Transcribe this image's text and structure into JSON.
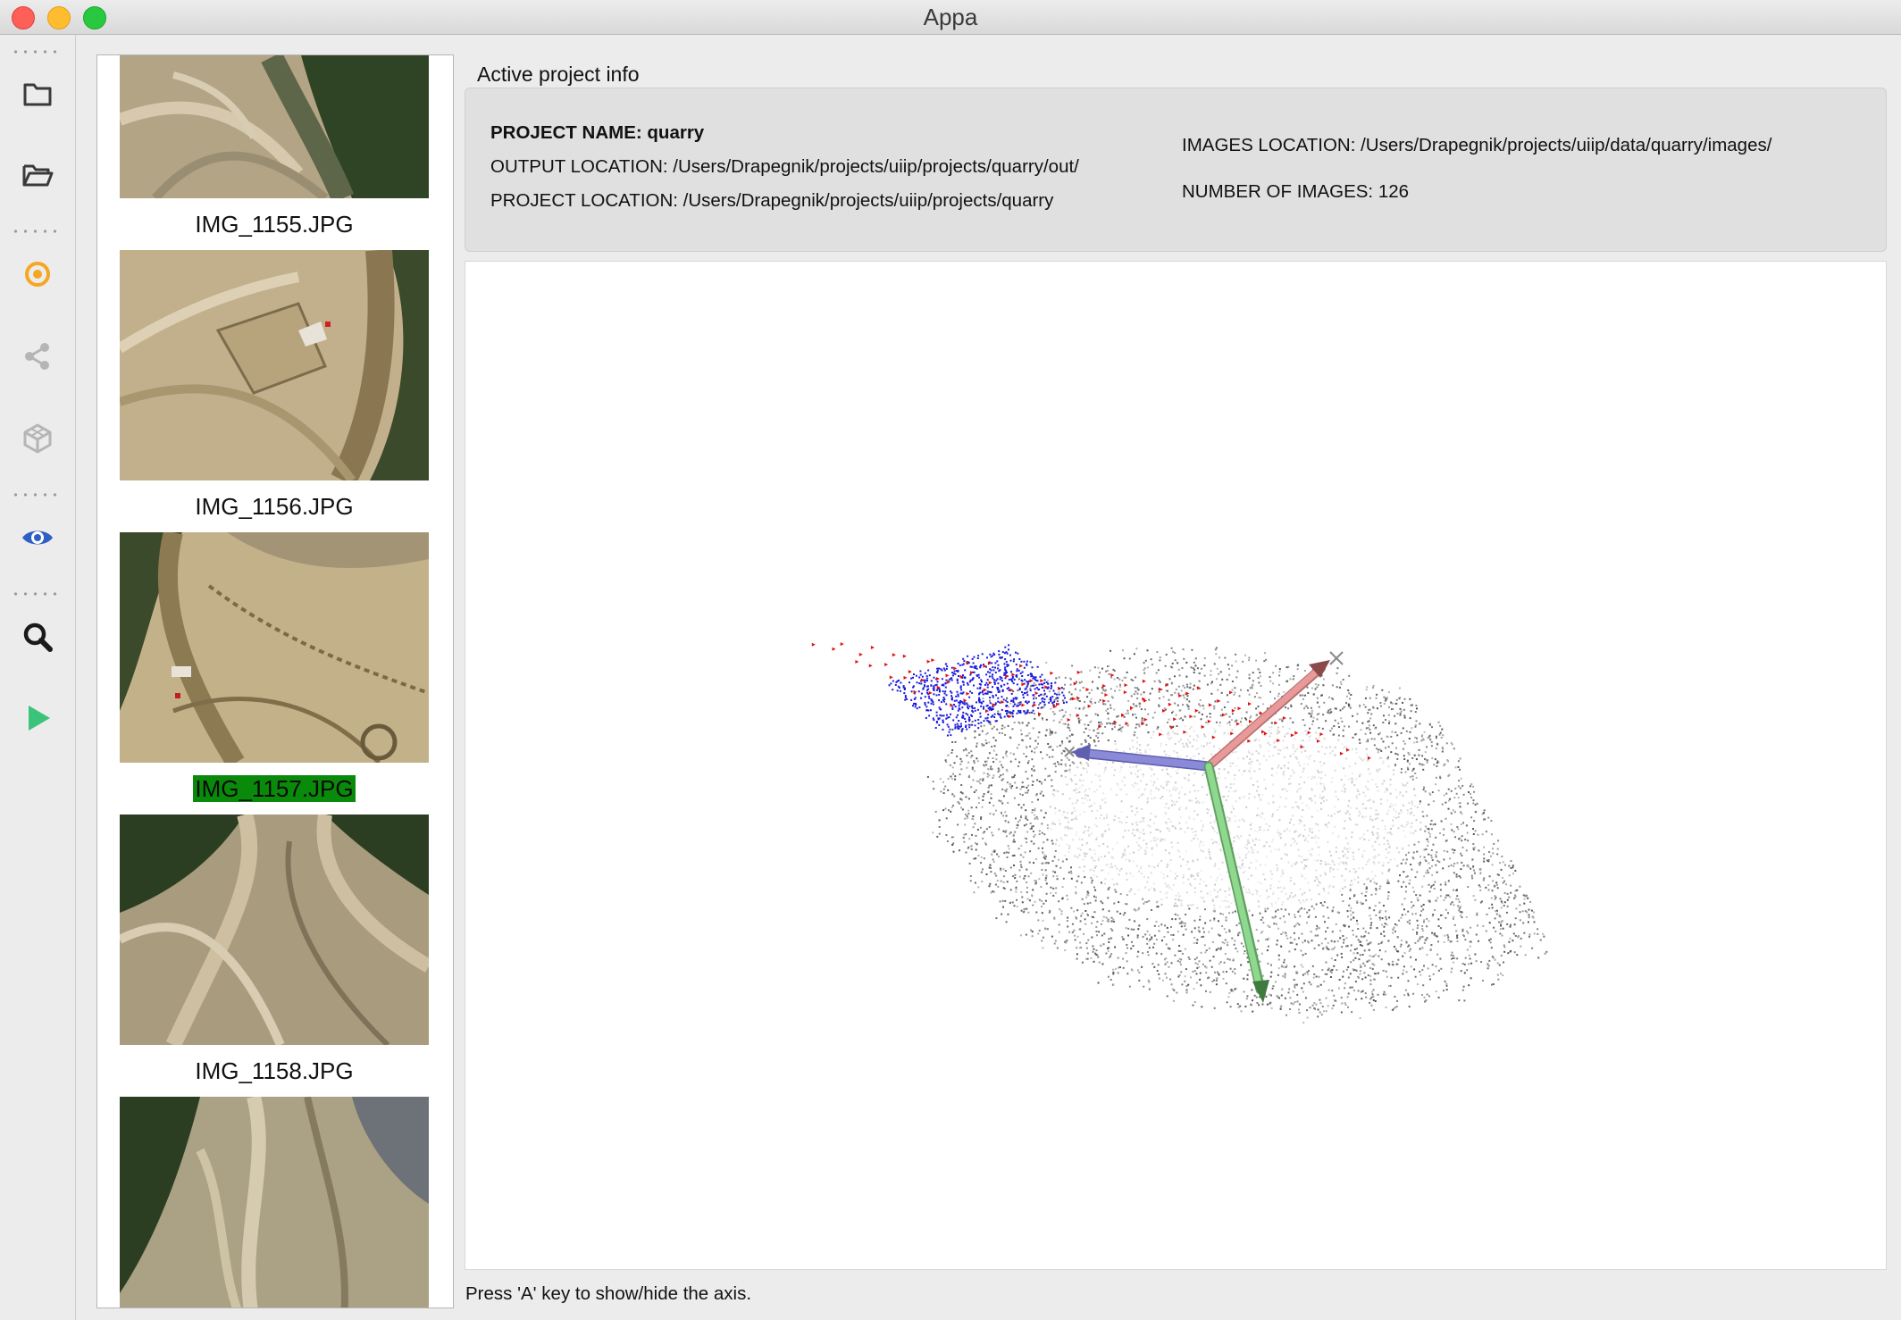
{
  "window": {
    "title": "Appa"
  },
  "toolbar": {
    "buttons": [
      {
        "name": "folder-icon",
        "color": "#3a3a3a"
      },
      {
        "name": "open-folder-icon",
        "color": "#3a3a3a"
      },
      {
        "name": "target-icon",
        "color": "#f5a623"
      },
      {
        "name": "share-icon",
        "color": "#b5b5b5"
      },
      {
        "name": "cube-icon",
        "color": "#b5b5b5"
      },
      {
        "name": "eye-icon",
        "color": "#2d5fc4"
      },
      {
        "name": "search-icon",
        "color": "#1a1a1a"
      },
      {
        "name": "play-icon",
        "color": "#3cc37a"
      }
    ]
  },
  "image_list": {
    "items": [
      {
        "label": "",
        "selected": false
      },
      {
        "label": "IMG_1155.JPG",
        "selected": false
      },
      {
        "label": "IMG_1156.JPG",
        "selected": false
      },
      {
        "label": "IMG_1157.JPG",
        "selected": true
      },
      {
        "label": "IMG_1158.JPG",
        "selected": false
      }
    ]
  },
  "project_info": {
    "section_title": "Active project info",
    "name_label": "PROJECT NAME: quarry",
    "output_location": "OUTPUT LOCATION: /Users/Drapegnik/projects/uiip/projects/quarry/out/",
    "project_location": "PROJECT LOCATION: /Users/Drapegnik/projects/uiip/projects/quarry",
    "images_location": "IMAGES LOCATION: /Users/Drapegnik/projects/uiip/data/quarry/images/",
    "number_of_images": "NUMBER OF IMAGES: 126"
  },
  "viewer": {
    "axis_colors": {
      "x": "#e89a9a",
      "y": "#8fd88f",
      "z": "#8a8ad8"
    },
    "camera_color": "#e01010",
    "highlight_color": "#1a1ae0"
  },
  "status": {
    "hint": "Press 'A' key to show/hide the axis."
  }
}
